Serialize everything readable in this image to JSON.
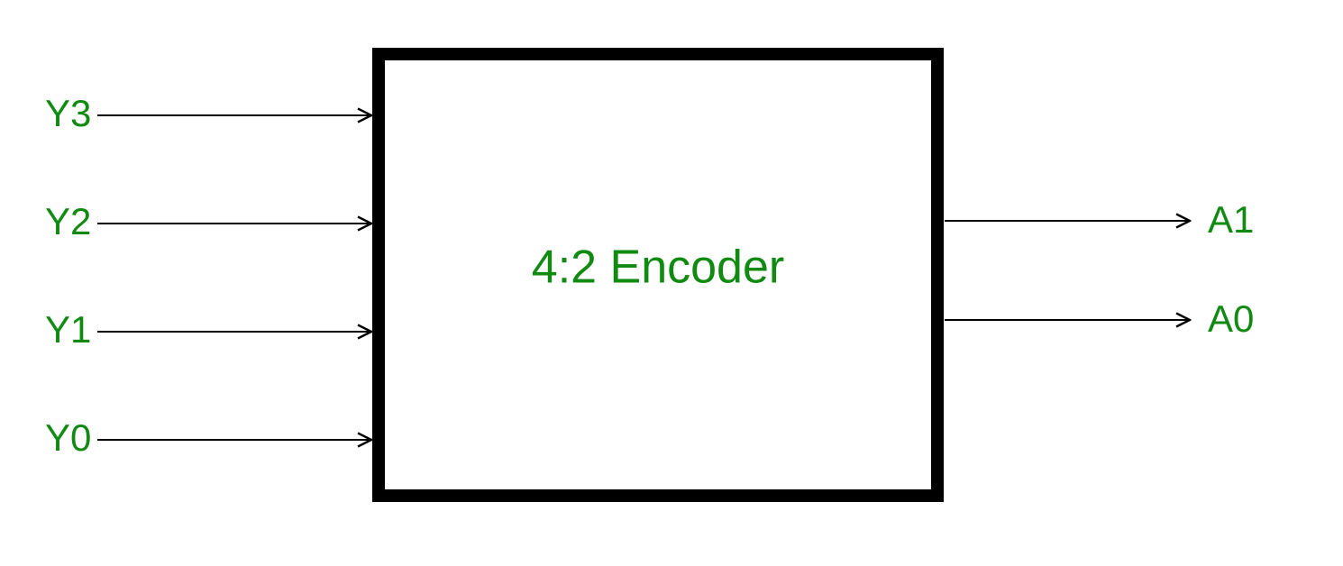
{
  "diagram": {
    "title": "4:2 Encoder",
    "inputs": [
      "Y3",
      "Y2",
      "Y1",
      "Y0"
    ],
    "outputs": [
      "A1",
      "A0"
    ]
  },
  "chart_data": {
    "type": "diagram",
    "component": "4:2 Encoder",
    "inputs": [
      "Y3",
      "Y2",
      "Y1",
      "Y0"
    ],
    "outputs": [
      "A1",
      "A0"
    ],
    "description": "Block diagram of a 4-to-2 line encoder. Four input lines Y3..Y0 on the left, two output lines A1, A0 on the right."
  }
}
